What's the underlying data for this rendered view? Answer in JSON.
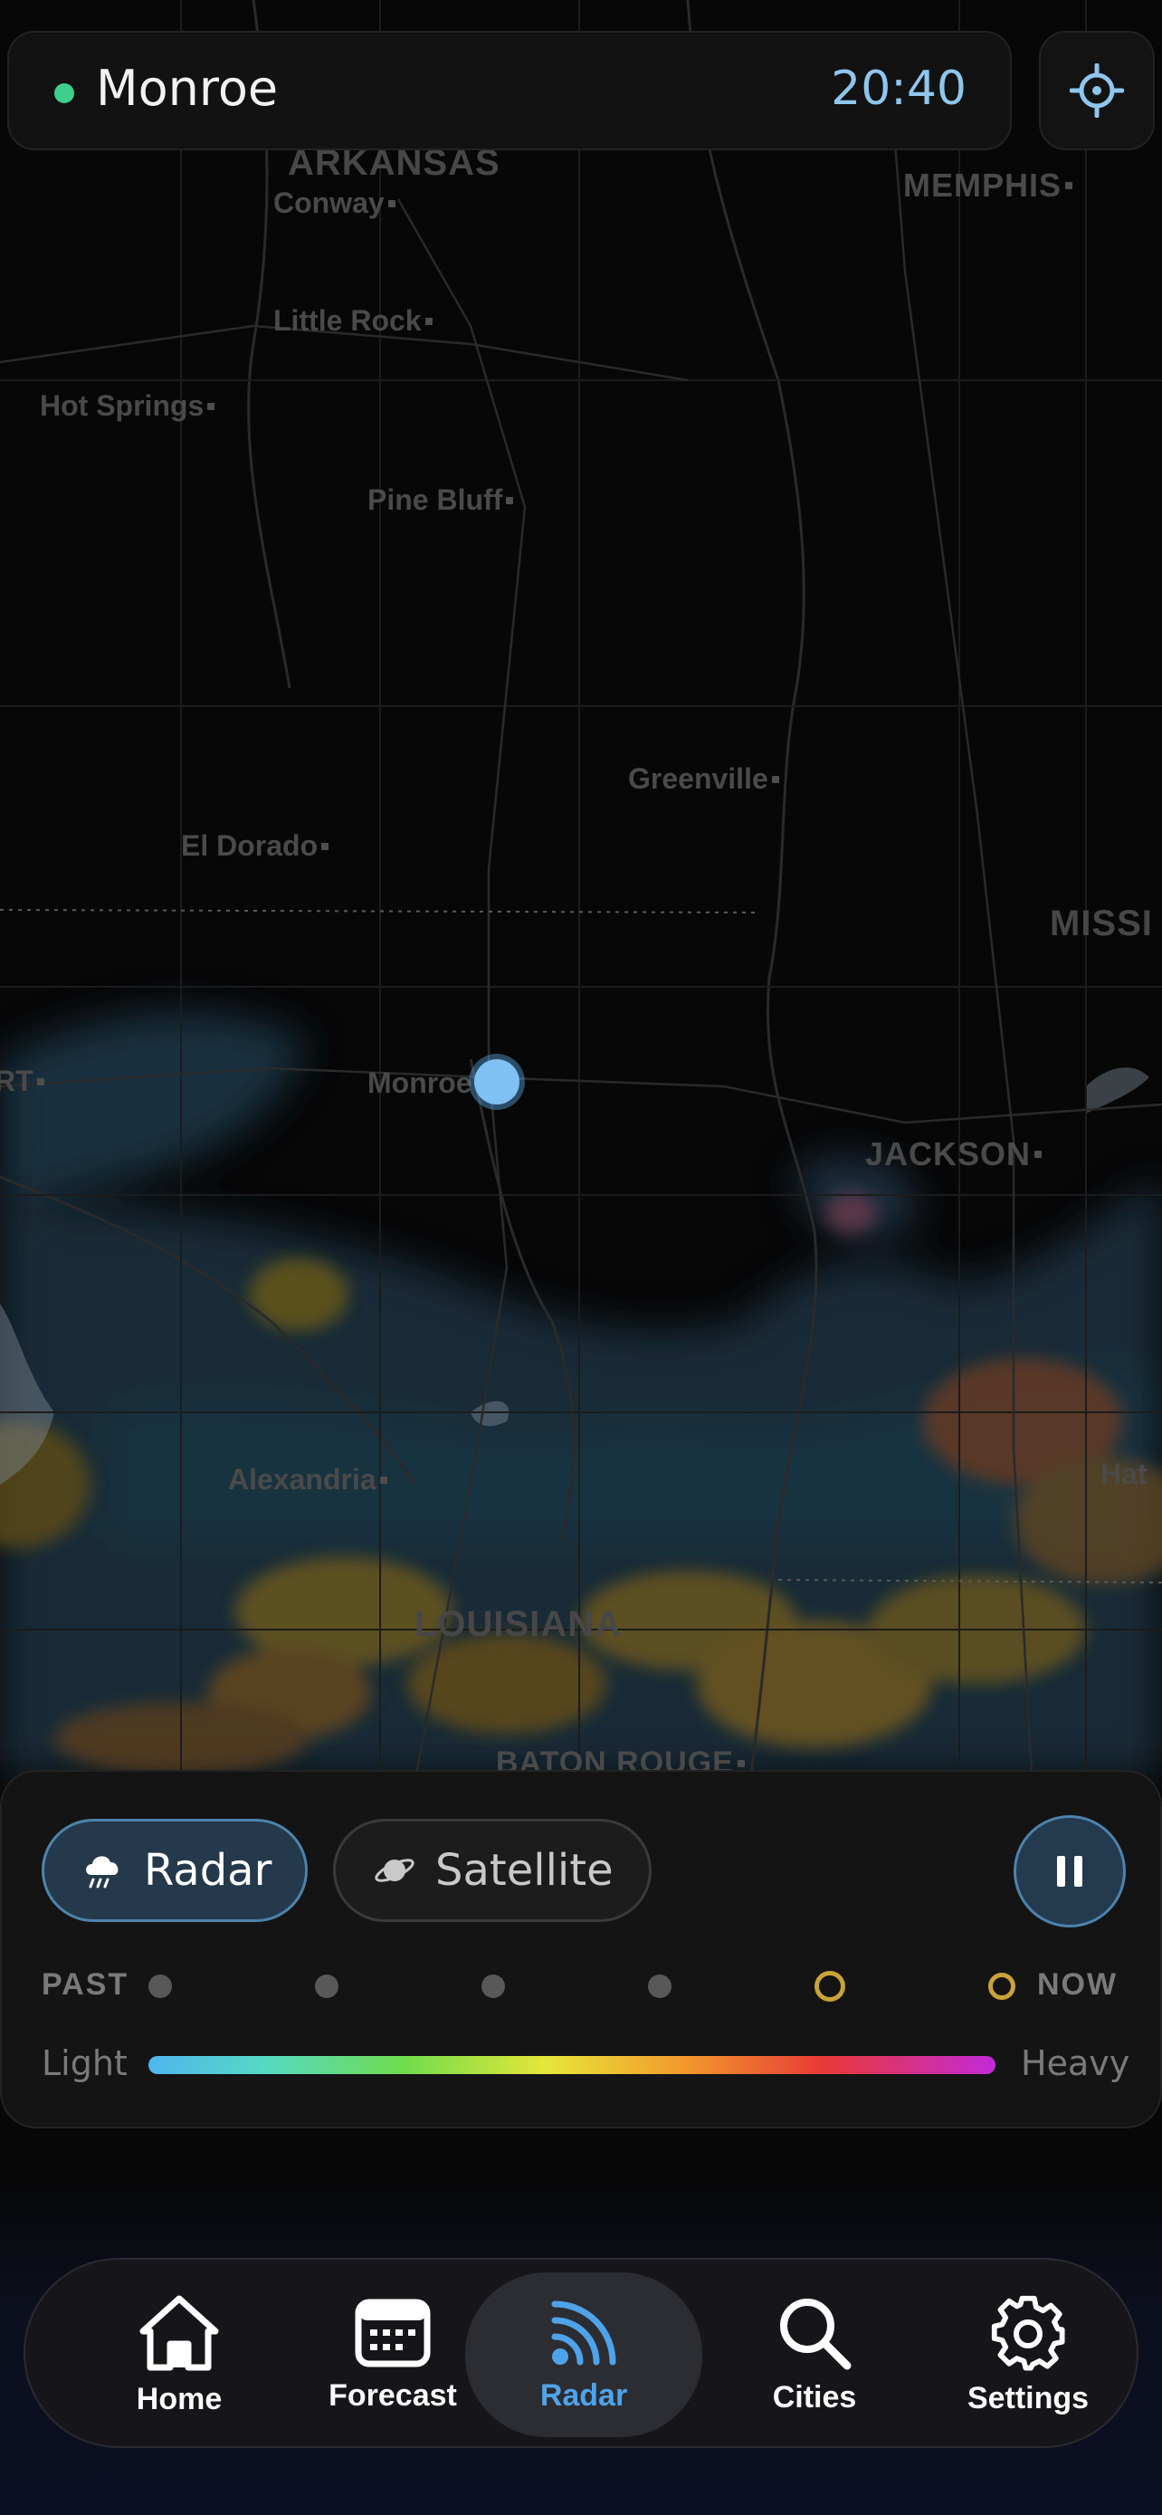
{
  "location": {
    "name": "Monroe",
    "time": "20:40",
    "status_color": "#3ecf8a"
  },
  "map": {
    "states": [
      "ARKANSAS",
      "MISSI",
      "LOUISIANA"
    ],
    "cities": [
      "Conway",
      "MEMPHIS",
      "Little Rock",
      "Hot Springs",
      "Pine Bluff",
      "Greenville",
      "El Dorado",
      "RT",
      "Monroe",
      "JACKSON",
      "Alexandria",
      "Hat",
      "BATON ROUGE"
    ]
  },
  "layers": {
    "radar_label": "Radar",
    "satellite_label": "Satellite",
    "active": "Radar"
  },
  "timeline": {
    "past_label": "PAST",
    "now_label": "NOW",
    "frames": 6,
    "current_frame": 5
  },
  "scale": {
    "light_label": "Light",
    "heavy_label": "Heavy"
  },
  "nav": {
    "items": [
      {
        "label": "Home",
        "icon": "home-icon"
      },
      {
        "label": "Forecast",
        "icon": "calendar-icon"
      },
      {
        "label": "Radar",
        "icon": "radar-icon"
      },
      {
        "label": "Cities",
        "icon": "search-icon"
      },
      {
        "label": "Settings",
        "icon": "gear-icon"
      }
    ],
    "active": "Radar",
    "active_color": "#4ea3ea"
  },
  "colors": {
    "accent": "#4ea3ea",
    "timeline_current": "#c9a23a"
  }
}
